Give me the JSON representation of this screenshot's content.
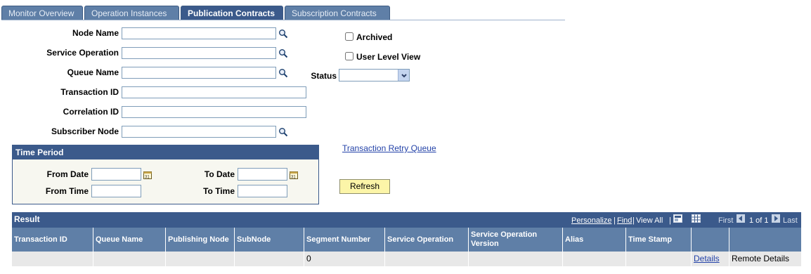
{
  "tabs": [
    {
      "label": "Monitor Overview",
      "active": false
    },
    {
      "label": "Operation Instances",
      "active": false
    },
    {
      "label": "Publication Contracts",
      "active": true
    },
    {
      "label": "Subscription Contracts",
      "active": false
    }
  ],
  "filters": {
    "node_name": {
      "label": "Node Name",
      "value": ""
    },
    "service_operation": {
      "label": "Service Operation",
      "value": ""
    },
    "queue_name": {
      "label": "Queue Name",
      "value": ""
    },
    "transaction_id": {
      "label": "Transaction ID",
      "value": ""
    },
    "correlation_id": {
      "label": "Correlation ID",
      "value": ""
    },
    "subscriber_node": {
      "label": "Subscriber Node",
      "value": ""
    },
    "archived": {
      "label": "Archived",
      "checked": false
    },
    "user_level_view": {
      "label": "User Level View",
      "checked": false
    },
    "status": {
      "label": "Status",
      "value": ""
    }
  },
  "time_period": {
    "title": "Time Period",
    "from_date": {
      "label": "From Date",
      "value": ""
    },
    "to_date": {
      "label": "To Date",
      "value": ""
    },
    "from_time": {
      "label": "From Time",
      "value": ""
    },
    "to_time": {
      "label": "To Time",
      "value": ""
    }
  },
  "links": {
    "transaction_retry_queue": "Transaction Retry Queue"
  },
  "buttons": {
    "refresh": "Refresh"
  },
  "result": {
    "title": "Result",
    "personalize": "Personalize",
    "find": "Find",
    "view_all": "View All",
    "sep1": "|",
    "sep2": "|",
    "sep3": "|",
    "first": "First",
    "page_info": "1 of 1",
    "last": "Last",
    "columns": [
      "Transaction ID",
      "Queue Name",
      "Publishing Node",
      "SubNode",
      "Segment Number",
      "Service Operation",
      "Service Operation Version",
      "Alias",
      "Time Stamp",
      "",
      ""
    ],
    "rows": [
      [
        "",
        "",
        "",
        "",
        "0",
        "",
        "",
        "",
        "",
        "Details",
        "Remote Details"
      ]
    ]
  },
  "colors": {
    "header_blue": "#3b5a8b",
    "column_blue": "#5f7fa7",
    "button_yellow": "#fcf5a8",
    "link": "#2342a8"
  }
}
